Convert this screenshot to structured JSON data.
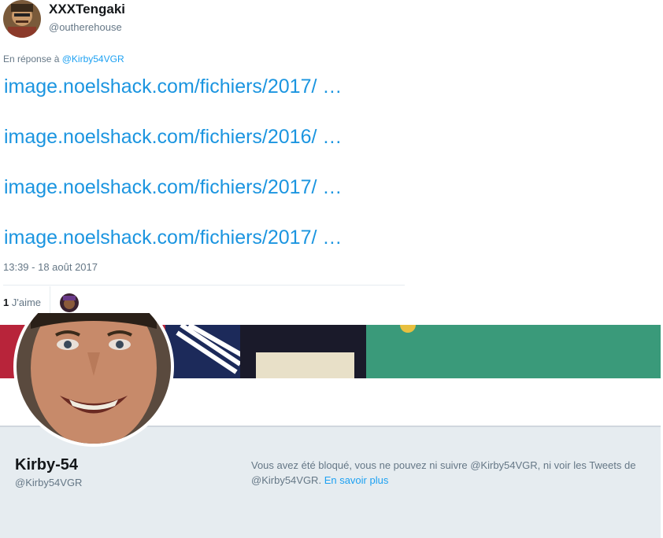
{
  "tweet": {
    "display_name": "XXXTengaki",
    "handle": "@outherehouse",
    "reply_prefix": "En réponse à",
    "reply_to": "@Kirby54VGR",
    "links": [
      "image.noelshack.com/fichiers/2017/ …",
      "image.noelshack.com/fichiers/2016/  …",
      "image.noelshack.com/fichiers/2017/ …",
      "image.noelshack.com/fichiers/2017/ …"
    ],
    "timestamp": "13:39 - 18 août 2017",
    "likes_count": "1",
    "likes_label": "J'aime"
  },
  "profile": {
    "name": "Kirby-54",
    "handle": "@Kirby54VGR",
    "blocked_message": "Vous avez été bloqué, vous ne pouvez ni suivre @Kirby54VGR, ni voir les Tweets de @Kirby54VGR.",
    "learn_more": "En savoir plus"
  },
  "colors": {
    "link": "#1b95e0",
    "muted": "#657786",
    "profile_bg": "#e6ecf0",
    "banner_green": "#2f8a6a"
  }
}
